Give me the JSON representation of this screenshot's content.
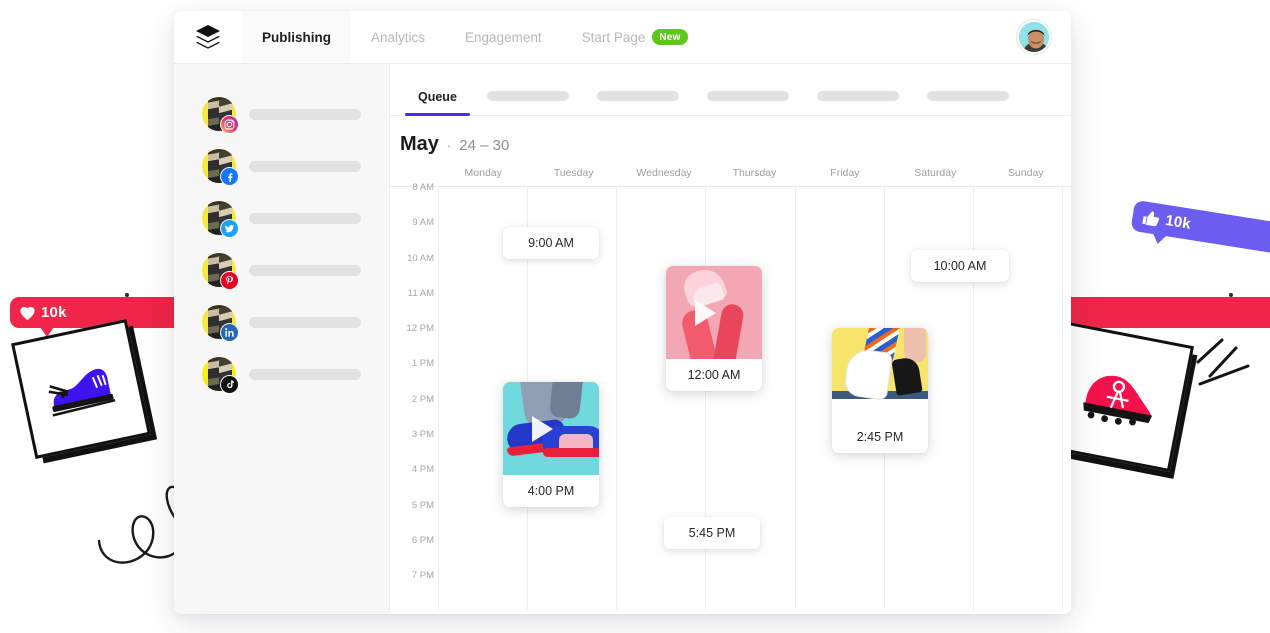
{
  "app": {
    "logo_icon": "buffer-layers-icon",
    "nav": [
      {
        "label": "Publishing",
        "active": true
      },
      {
        "label": "Analytics",
        "active": false
      },
      {
        "label": "Engagement",
        "active": false
      },
      {
        "label": "Start Page",
        "active": false,
        "badge": "New"
      }
    ],
    "avatar_icon": "user-avatar"
  },
  "sidebar": {
    "accounts": [
      {
        "platform": "instagram",
        "glyph": "◉",
        "color": "#e1306c"
      },
      {
        "platform": "facebook",
        "glyph": "f",
        "color": "#1877f2"
      },
      {
        "platform": "twitter",
        "glyph": "🐦",
        "color": "#1da1f2"
      },
      {
        "platform": "pinterest",
        "glyph": "P",
        "color": "#e60023"
      },
      {
        "platform": "linkedin",
        "glyph": "in",
        "color": "#2867b2"
      },
      {
        "platform": "tiktok",
        "glyph": "♪",
        "color": "#111111"
      }
    ]
  },
  "main": {
    "tabs": [
      {
        "label": "Queue",
        "active": true
      },
      {
        "label": "",
        "active": false
      },
      {
        "label": "",
        "active": false
      },
      {
        "label": "",
        "active": false
      },
      {
        "label": "",
        "active": false
      },
      {
        "label": "",
        "active": false
      }
    ],
    "date_header": {
      "month": "May",
      "separator": "·",
      "range": "24 – 30"
    },
    "accent_color": "#4d28f0",
    "day_names": [
      "Monday",
      "Tuesday",
      "Wednesday",
      "Thursday",
      "Friday",
      "Saturday",
      "Sunday"
    ],
    "time_labels": [
      "8 AM",
      "9 AM",
      "10 AM",
      "11 AM",
      "12 PM",
      "1 PM",
      "2 PM",
      "3 PM",
      "4 PM",
      "5 PM",
      "6 PM",
      "7 PM"
    ],
    "posts": [
      {
        "time": "9:00 AM",
        "day": "Tuesday",
        "has_media": false
      },
      {
        "time": "10:00 AM",
        "day": "Sunday",
        "has_media": false
      },
      {
        "time": "12:00 AM",
        "day": "Thursday",
        "has_media": true,
        "media": "pink-hands-sneaker",
        "video": true
      },
      {
        "time": "2:45 PM",
        "day": "Saturday",
        "has_media": true,
        "media": "yellow-white-sneaker",
        "video": false
      },
      {
        "time": "4:00 PM",
        "day": "Tuesday",
        "has_media": true,
        "media": "teal-blue-sneakers",
        "video": true
      },
      {
        "time": "5:45 PM",
        "day": "Thursday",
        "has_media": false
      }
    ]
  },
  "decorations": {
    "heart_badge": {
      "icon": "heart-icon",
      "glyph": "♥",
      "count": "10k",
      "color": "#f02549"
    },
    "like_badge": {
      "icon": "thumbs-up-icon",
      "glyph": "👍",
      "count": "10k",
      "color": "#6b5df0"
    },
    "shoe_card_left": {
      "icon": "blue-sneaker-illustration"
    },
    "shoe_card_right": {
      "icon": "red-cleat-illustration"
    },
    "scribble": {
      "icon": "loop-scribble-doodle"
    },
    "speed_lines": {
      "icon": "speed-lines-doodle"
    },
    "ball": {
      "icon": "striped-sphere-doodle"
    }
  }
}
